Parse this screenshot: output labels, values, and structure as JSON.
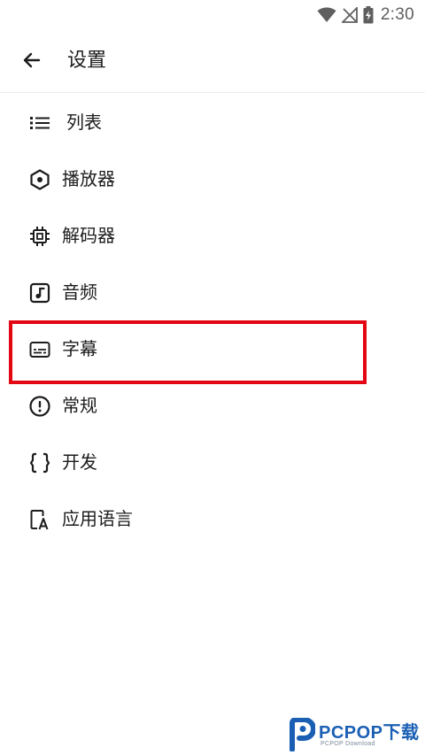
{
  "status_bar": {
    "time": "2:30",
    "icons": [
      "wifi-icon",
      "no-signal-icon",
      "battery-charging-icon"
    ]
  },
  "app_bar": {
    "title": "设置",
    "back_icon": "arrow-back-icon"
  },
  "menu": {
    "items": [
      {
        "label": "列表",
        "icon": "list-icon"
      },
      {
        "label": "播放器",
        "icon": "hexagon-dot-icon"
      },
      {
        "label": "解码器",
        "icon": "chip-icon"
      },
      {
        "label": "音频",
        "icon": "music-note-icon"
      },
      {
        "label": "字幕",
        "icon": "subtitles-icon",
        "highlighted": true
      },
      {
        "label": "常规",
        "icon": "alert-circle-icon"
      },
      {
        "label": "开发",
        "icon": "code-braces-icon"
      },
      {
        "label": "应用语言",
        "icon": "app-language-icon"
      }
    ]
  },
  "highlight": {
    "color": "#e30613",
    "target": "字幕"
  },
  "watermark": {
    "text": "PCPOP下载",
    "subtext": "PCPOP Download",
    "color": "#1a5fb4"
  }
}
